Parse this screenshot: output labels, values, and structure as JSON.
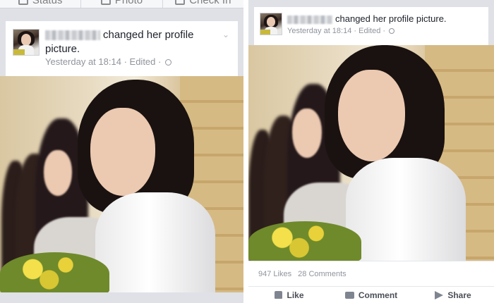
{
  "left_post": {
    "composer": [
      {
        "label": "Status",
        "icon": "pencil-icon"
      },
      {
        "label": "Photo",
        "icon": "camera-icon"
      },
      {
        "label": "Check In",
        "icon": "checkin-icon"
      }
    ],
    "story_text": "changed her profile picture.",
    "timestamp": "Yesterday at 18:14",
    "edited": "Edited",
    "separator": "·"
  },
  "right_post": {
    "story_text": "changed her profile picture.",
    "timestamp": "Yesterday at 18:14",
    "edited": "Edited",
    "separator": "·",
    "likes": "947 Likes",
    "comments": "28 Comments",
    "actions": {
      "like": "Like",
      "comment": "Comment",
      "share": "Share"
    }
  },
  "colors": {
    "feed_bg": "#dfe1e6",
    "meta_gray": "#90949c",
    "text_dark": "#1d2129"
  }
}
